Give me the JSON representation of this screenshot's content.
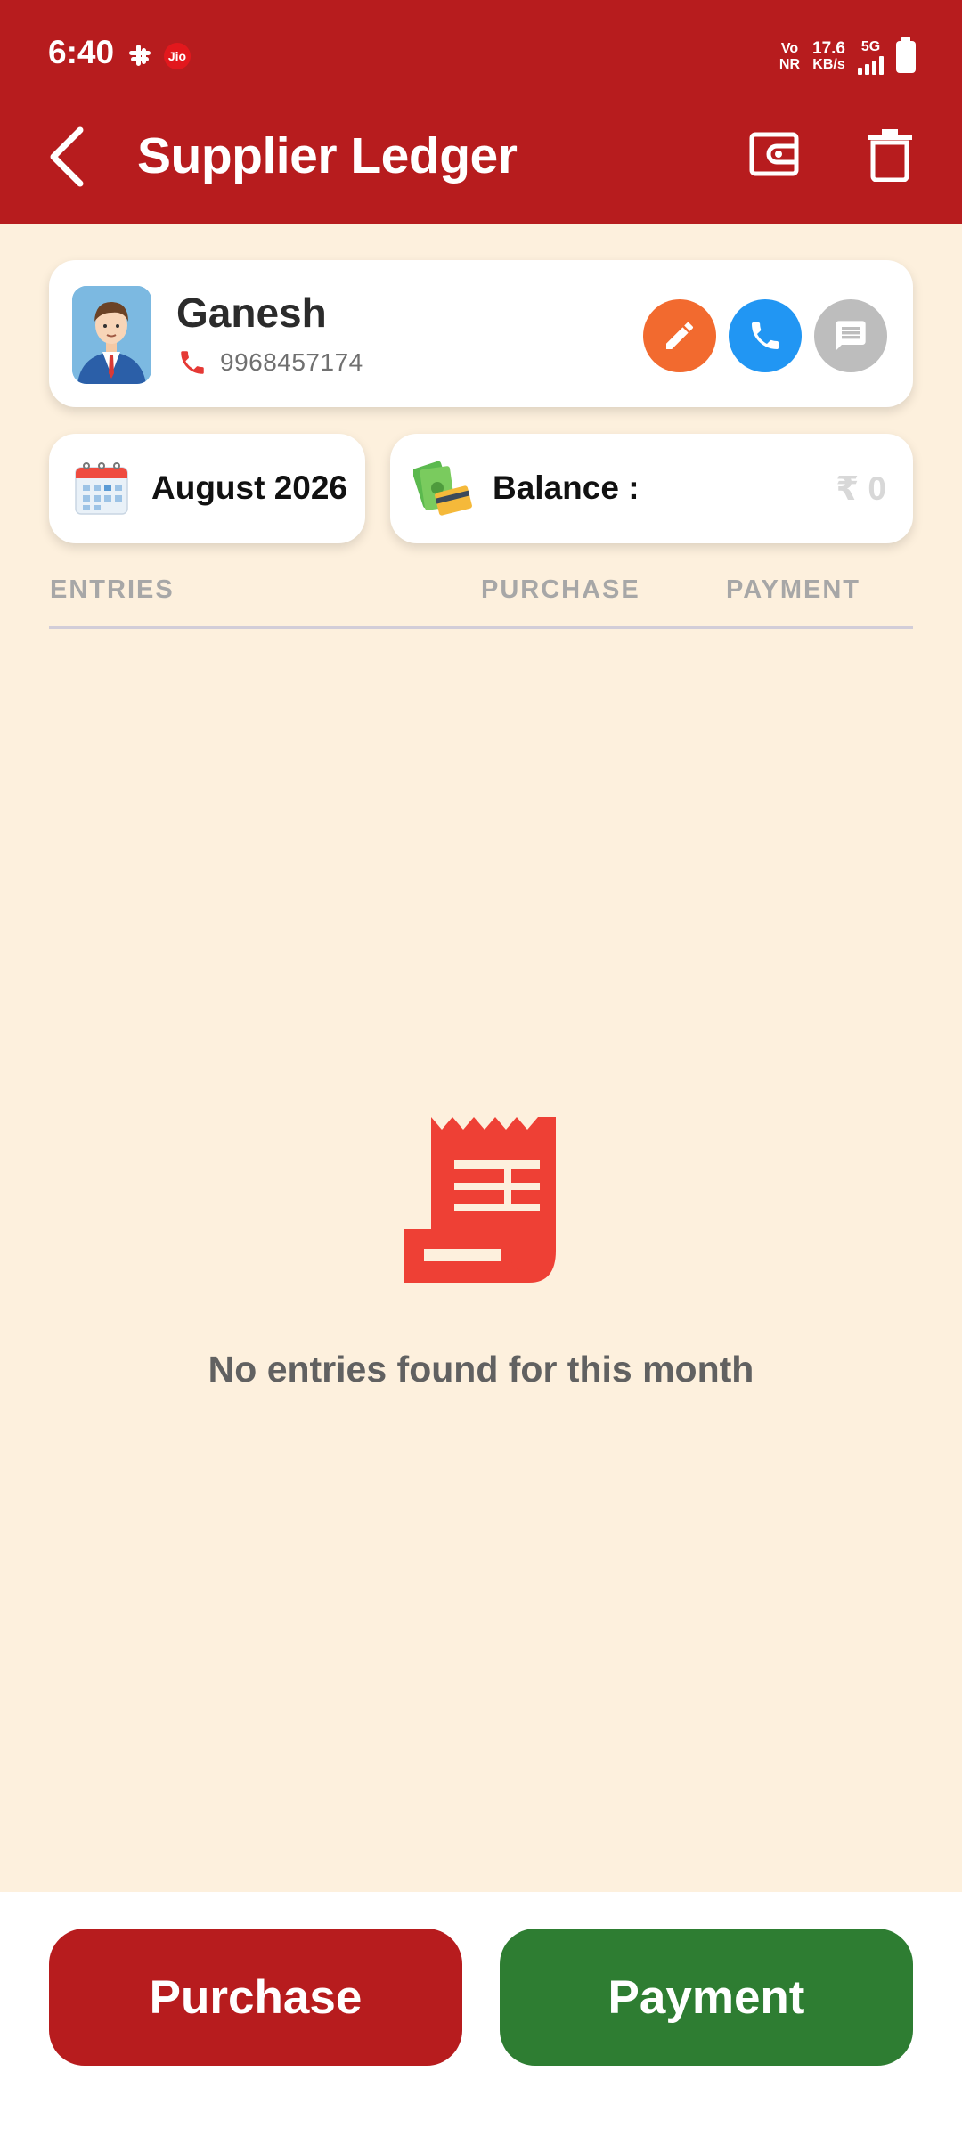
{
  "status_bar": {
    "time": "6:40",
    "carrier_badge": "Jio",
    "vo": "Vo",
    "nr": "NR",
    "speed_value": "17.6",
    "speed_unit": "KB/s",
    "network": "5G"
  },
  "app_bar": {
    "title": "Supplier Ledger",
    "back_icon": "chevron-left-icon",
    "wallet_icon": "wallet-icon",
    "delete_icon": "trash-icon"
  },
  "supplier": {
    "name": "Ganesh",
    "phone": "9968457174",
    "actions": [
      {
        "name": "edit",
        "icon": "pencil-icon",
        "color": "#F26A2F"
      },
      {
        "name": "call",
        "icon": "phone-icon",
        "color": "#2196F3"
      },
      {
        "name": "message",
        "icon": "message-icon",
        "color": "#BDBDBD"
      }
    ]
  },
  "period": {
    "month": "August 2026"
  },
  "balance": {
    "label": "Balance :",
    "value": "₹ 0"
  },
  "table": {
    "columns": [
      "ENTRIES",
      "PURCHASE",
      "PAYMENT"
    ]
  },
  "empty_state": {
    "icon": "receipt-icon",
    "message": "No entries found for this month"
  },
  "bottom_actions": {
    "purchase_label": "Purchase",
    "payment_label": "Payment"
  },
  "colors": {
    "primary_red": "#B71C1E",
    "primary_green": "#2E7D32",
    "background": "#FDF0DD",
    "accent_orange": "#F26A2F",
    "accent_blue": "#2196F3",
    "empty_icon_red": "#EE4035"
  }
}
